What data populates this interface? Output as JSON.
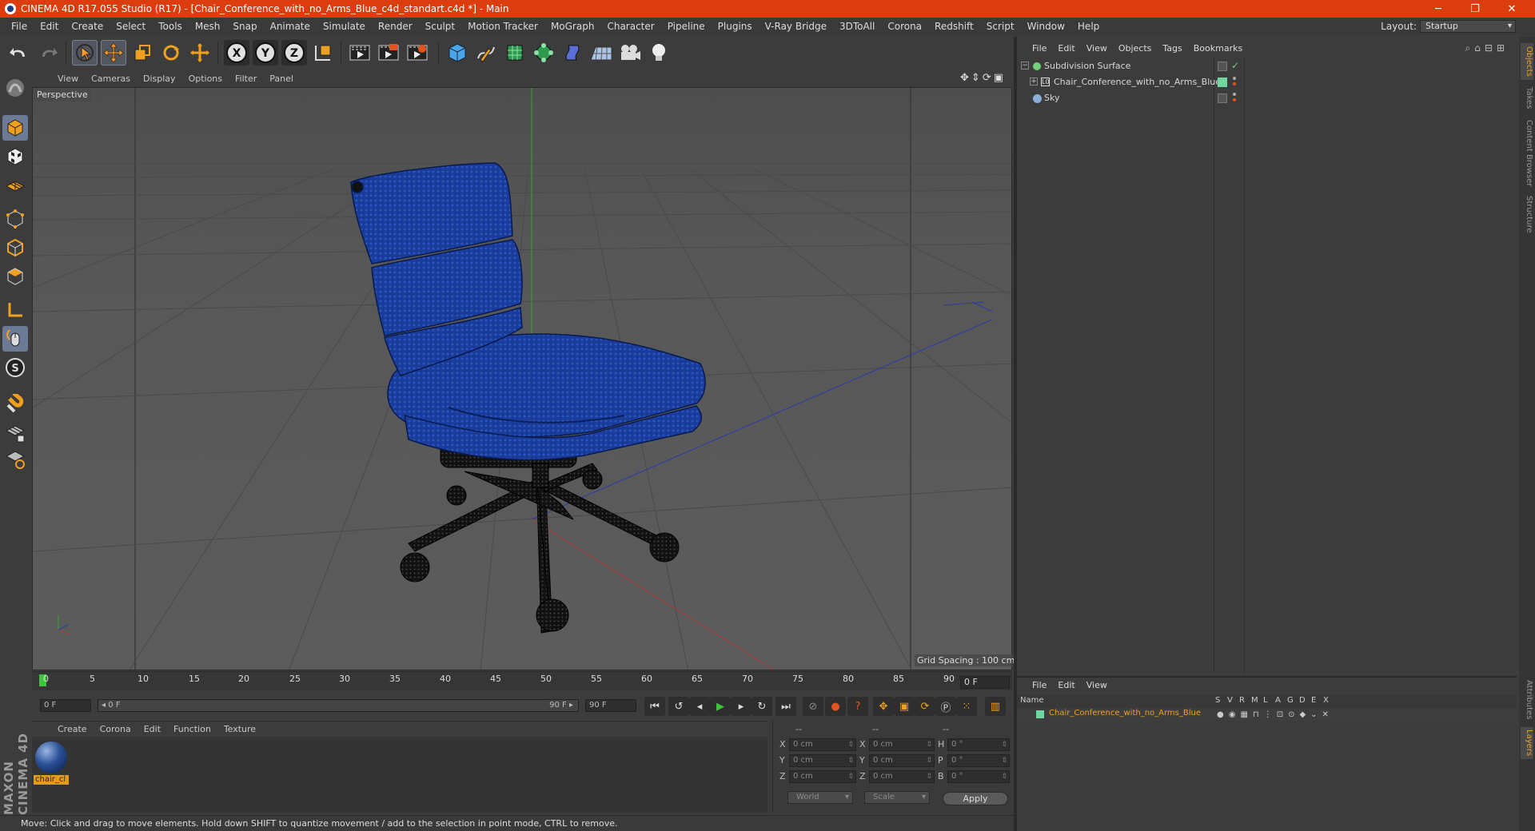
{
  "window": {
    "title": "CINEMA 4D R17.055 Studio (R17) - [Chair_Conference_with_no_Arms_Blue_c4d_standart.c4d *] - Main",
    "minimize_glyph": "─",
    "maximize_glyph": "❐",
    "close_glyph": "✕"
  },
  "menubar": {
    "items": [
      "File",
      "Edit",
      "Create",
      "Select",
      "Tools",
      "Mesh",
      "Snap",
      "Animate",
      "Simulate",
      "Render",
      "Sculpt",
      "Motion Tracker",
      "MoGraph",
      "Character",
      "Pipeline",
      "Plugins",
      "V-Ray Bridge",
      "3DToAll",
      "Corona",
      "Redshift",
      "Script",
      "Window",
      "Help"
    ],
    "layout_label": "Layout:",
    "layout_value": "Startup"
  },
  "toolbar": {
    "axis_x": "X",
    "axis_y": "Y",
    "axis_z": "Z",
    "icons": [
      "undo-icon",
      "redo-icon",
      "select-arrow-icon",
      "move-icon",
      "scale-icon",
      "rotate-icon",
      "move-alt-icon",
      "axis-x-icon",
      "axis-y-icon",
      "axis-z-icon",
      "world-coords-icon",
      "render-view-icon",
      "render-picture-viewer-icon",
      "render-settings-icon",
      "cube-icon",
      "pen-spline-icon",
      "subdivision-icon",
      "array-icon",
      "deformer-icon",
      "floor-icon",
      "camera-icon",
      "light-icon"
    ]
  },
  "viewport": {
    "menu": [
      "View",
      "Cameras",
      "Display",
      "Options",
      "Filter",
      "Panel"
    ],
    "label": "Perspective",
    "grid_spacing": "Grid Spacing : 100 cm"
  },
  "timeline": {
    "ticks": [
      "0",
      "5",
      "10",
      "15",
      "20",
      "25",
      "30",
      "35",
      "40",
      "45",
      "50",
      "55",
      "60",
      "65",
      "70",
      "75",
      "80",
      "85",
      "90"
    ],
    "current_frame": "0 F",
    "start_field": "0 F",
    "range_start": "◂ 0 F",
    "range_end": "90 F ▸",
    "end_field": "90 F"
  },
  "material_manager": {
    "menu": [
      "Create",
      "Corona",
      "Edit",
      "Function",
      "Texture"
    ],
    "material_name": "chair_cl"
  },
  "coordinates": {
    "headers": [
      "--",
      "--",
      "--"
    ],
    "rows": [
      {
        "l1": "X",
        "v1": "0 cm",
        "l2": "X",
        "v2": "0 cm",
        "l3": "H",
        "v3": "0 °"
      },
      {
        "l1": "Y",
        "v1": "0 cm",
        "l2": "Y",
        "v2": "0 cm",
        "l3": "P",
        "v3": "0 °"
      },
      {
        "l1": "Z",
        "v1": "0 cm",
        "l2": "Z",
        "v2": "0 cm",
        "l3": "B",
        "v3": "0 °"
      }
    ],
    "mode": "World",
    "transform": "Scale",
    "apply": "Apply"
  },
  "status": {
    "text": "Move: Click and drag to move elements. Hold down SHIFT to quantize movement / add to the selection in point mode, CTRL to remove."
  },
  "object_manager": {
    "menu": [
      "File",
      "Edit",
      "View",
      "Objects",
      "Tags",
      "Bookmarks"
    ],
    "objects": [
      {
        "name": "Subdivision Surface",
        "color": "#6fd27a"
      },
      {
        "name": "Chair_Conference_with_no_Arms_Blue",
        "color": "#b8b8b8"
      },
      {
        "name": "Sky",
        "color": "#8ab0d8"
      }
    ]
  },
  "right_tabs": [
    "Objects",
    "Takes",
    "Content Browser",
    "Structure"
  ],
  "right_tabs_bottom": [
    "Attributes",
    "Layers"
  ],
  "layer_manager": {
    "menu": [
      "File",
      "Edit",
      "View"
    ],
    "columns": [
      "Name",
      "S",
      "V",
      "R",
      "M",
      "L",
      "A",
      "G",
      "D",
      "E",
      "X"
    ],
    "layer_name": "Chair_Conference_with_no_Arms_Blue",
    "layer_color": "#f0a020"
  },
  "branding": {
    "logo_text": "MAXON CINEMA 4D"
  },
  "colors": {
    "title_bar": "#dc3d0e",
    "accent_orange": "#e6a22a",
    "chair_blue": "#1a3c9a"
  }
}
